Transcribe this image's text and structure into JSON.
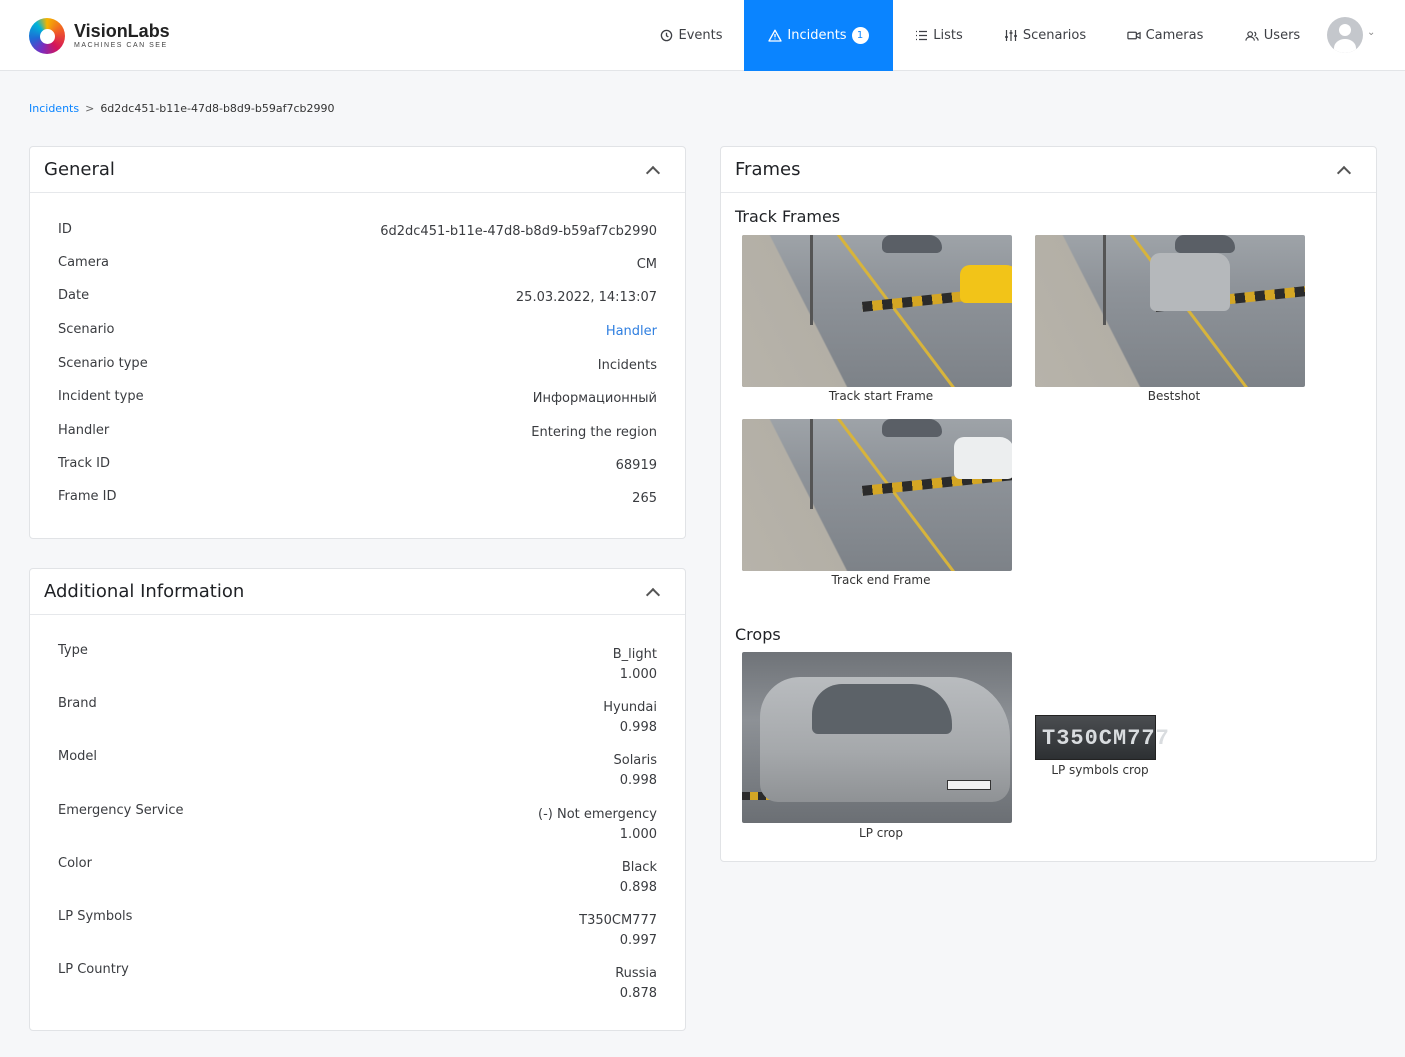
{
  "brand": {
    "name": "VisionLabs",
    "tagline": "MACHINES CAN SEE"
  },
  "nav": {
    "events": "Events",
    "incidents": "Incidents",
    "incidents_badge": "1",
    "lists": "Lists",
    "scenarios": "Scenarios",
    "cameras": "Cameras",
    "users": "Users"
  },
  "breadcrumb": {
    "parent": "Incidents",
    "separator": ">",
    "current": "6d2dc451-b11e-47d8-b8d9-b59af7cb2990"
  },
  "general": {
    "title": "General",
    "rows": [
      {
        "label": "ID",
        "value": "6d2dc451-b11e-47d8-b8d9-b59af7cb2990"
      },
      {
        "label": "Camera",
        "value": "CM"
      },
      {
        "label": "Date",
        "value": "25.03.2022, 14:13:07"
      },
      {
        "label": "Scenario",
        "value": "Handler"
      },
      {
        "label": "Scenario type",
        "value": "Incidents"
      },
      {
        "label": "Incident type",
        "value": "Информационный"
      },
      {
        "label": "Handler",
        "value": "Entering the region"
      },
      {
        "label": "Track ID",
        "value": "68919"
      },
      {
        "label": "Frame ID",
        "value": "265"
      }
    ]
  },
  "additional": {
    "title": "Additional Information",
    "rows": [
      {
        "label": "Type",
        "value": "B_light",
        "score": "1.000"
      },
      {
        "label": "Brand",
        "value": "Hyundai",
        "score": "0.998"
      },
      {
        "label": "Model",
        "value": "Solaris",
        "score": "0.998"
      },
      {
        "label": "Emergency Service",
        "value": "(-) Not emergency",
        "score": "1.000"
      },
      {
        "label": "Color",
        "value": "Black",
        "score": "0.898"
      },
      {
        "label": "LP Symbols",
        "value": "T350CM777",
        "score": "0.997"
      },
      {
        "label": "LP Country",
        "value": "Russia",
        "score": "0.878"
      }
    ]
  },
  "frames": {
    "title": "Frames",
    "track_frames_title": "Track Frames",
    "track_start": "Track start Frame",
    "bestshot": "Bestshot",
    "track_end": "Track end Frame",
    "crops_title": "Crops",
    "lp_crop": "LP crop",
    "lp_symbols_crop": "LP symbols crop",
    "plate_text": "T350CM777"
  },
  "colors": {
    "accent": "#0a84ff",
    "link": "#2f7fe0"
  }
}
